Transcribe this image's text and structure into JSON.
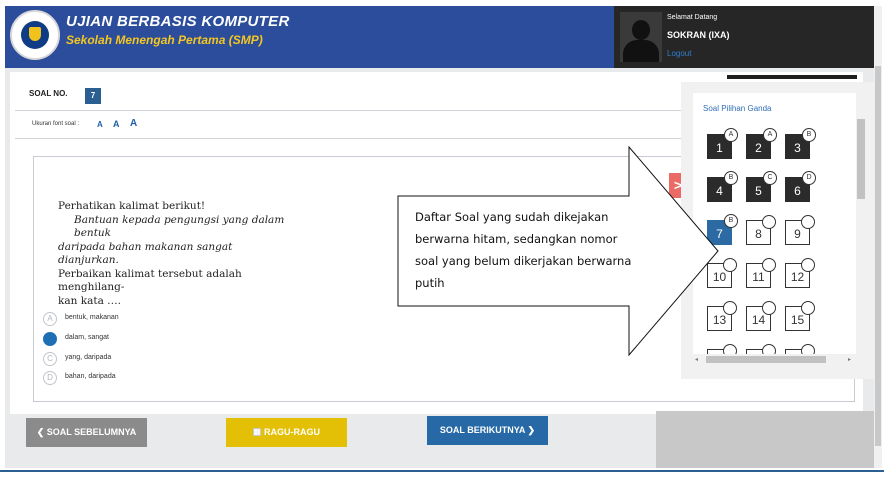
{
  "header": {
    "title": "UJIAN BERBASIS KOMPUTER",
    "subtitle": "Sekolah Menengah Pertama (SMP)",
    "welcome": "Selamat Datang",
    "username": "SOKRAN (IXA)",
    "logout": "Logout"
  },
  "question": {
    "label": "SOAL NO.",
    "number": "7",
    "font_size_label": "Ukuran font soal :",
    "font_buttons": [
      "A",
      "A",
      "A"
    ],
    "text_lines": [
      "Perhatikan kalimat berikut!",
      "Bantuan kepada pengungsi yang dalam bentuk",
      "daripada bahan makanan sangat dianjurkan.",
      "Perbaikan kalimat tersebut adalah menghilang-",
      "kan kata …."
    ],
    "options": [
      {
        "letter": "A",
        "text": "bentuk, makanan",
        "selected": false
      },
      {
        "letter": "B",
        "text": "dalam, sangat",
        "selected": true
      },
      {
        "letter": "C",
        "text": "yang, daripada",
        "selected": false
      },
      {
        "letter": "D",
        "text": "bahan, daripada",
        "selected": false
      }
    ],
    "next_arrow": ">"
  },
  "buttons": {
    "prev": "❮  SOAL SEBELUMNYA",
    "ragu": "RAGU-RAGU",
    "next": "SOAL BERIKUTNYA  ❯"
  },
  "callout": {
    "lines": [
      "Daftar Soal yang sudah dikejakan",
      "berwarna hitam, sedangkan nomor",
      "soal yang belum dikerjakan berwarna",
      "putih"
    ]
  },
  "question_list": {
    "title": "Soal Pilihan Ganda",
    "items": [
      {
        "num": "1",
        "answer": "A",
        "state": "done"
      },
      {
        "num": "2",
        "answer": "A",
        "state": "done"
      },
      {
        "num": "3",
        "answer": "B",
        "state": "done"
      },
      {
        "num": "4",
        "answer": "B",
        "state": "done"
      },
      {
        "num": "5",
        "answer": "C",
        "state": "done"
      },
      {
        "num": "6",
        "answer": "D",
        "state": "done"
      },
      {
        "num": "7",
        "answer": "B",
        "state": "current"
      },
      {
        "num": "8",
        "answer": "",
        "state": "todo"
      },
      {
        "num": "9",
        "answer": "",
        "state": "todo"
      },
      {
        "num": "10",
        "answer": "",
        "state": "todo"
      },
      {
        "num": "11",
        "answer": "",
        "state": "todo"
      },
      {
        "num": "12",
        "answer": "",
        "state": "todo"
      },
      {
        "num": "13",
        "answer": "",
        "state": "todo"
      },
      {
        "num": "14",
        "answer": "",
        "state": "todo"
      },
      {
        "num": "15",
        "answer": "",
        "state": "todo"
      },
      {
        "num": "",
        "answer": "",
        "state": "todo"
      },
      {
        "num": "",
        "answer": "",
        "state": "todo"
      },
      {
        "num": "",
        "answer": "",
        "state": "todo"
      }
    ]
  },
  "colors": {
    "header_bg": "#2b4d9b",
    "subtitle": "#f4c623",
    "done": "#2b2b2b",
    "current": "#2c6aa3",
    "ragu": "#e3c006",
    "next": "#2669a6",
    "prev": "#8b8b8b",
    "arrow": "#ea6b66"
  }
}
